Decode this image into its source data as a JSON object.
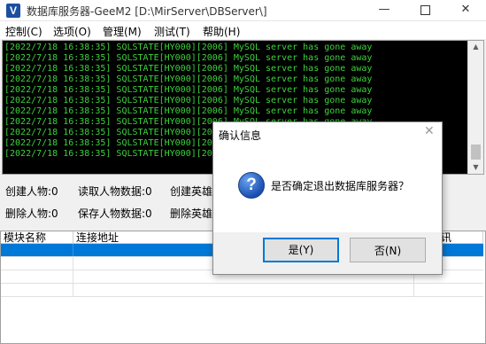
{
  "window": {
    "title": "数据库服务器-GeeM2  [D:\\MirServer\\DBServer\\]",
    "icon_letter": "V",
    "minimize": "—",
    "close": "✕"
  },
  "menu": [
    "控制(C)",
    "选项(O)",
    "管理(M)",
    "测试(T)",
    "帮助(H)"
  ],
  "log_lines": [
    "[2022/7/18 16:38:35] SQLSTATE[HY000][2006] MySQL server has gone away",
    "[2022/7/18 16:38:35] SQLSTATE[HY000][2006] MySQL server has gone away",
    "[2022/7/18 16:38:35] SQLSTATE[HY000][2006] MySQL server has gone away",
    "[2022/7/18 16:38:35] SQLSTATE[HY000][2006] MySQL server has gone away",
    "[2022/7/18 16:38:35] SQLSTATE[HY000][2006] MySQL server has gone away",
    "[2022/7/18 16:38:35] SQLSTATE[HY000][2006] MySQL server has gone away",
    "[2022/7/18 16:38:35] SQLSTATE[HY000][2006] MySQL server has gone away",
    "[2022/7/18 16:38:35] SQLSTATE[HY000][2006] MySQL server has gone away",
    "[2022/7/18 16:38:35] SQLSTATE[HY000][2006] MySQL server has gone away",
    "[2022/7/18 16:38:35] SQLSTATE[HY000][2006] MySQL server has gone away",
    "[2022/7/18 16:38:35] SQLSTATE[HY000][2006] MySQL server has gone away"
  ],
  "stats": {
    "create_char": "创建人物:0",
    "read_char": "读取人物数据:0",
    "create_hero": "创建英雄",
    "delete_char": "删除人物:0",
    "save_char": "保存人物数据:0",
    "delete_hero": "删除英雄"
  },
  "table": {
    "columns": [
      "模块名称",
      "连接地址",
      "讯"
    ]
  },
  "dialog": {
    "title": "确认信息",
    "close": "✕",
    "icon_glyph": "?",
    "message": "是否确定退出数据库服务器？",
    "yes": "是(Y)",
    "no": "否(N)"
  },
  "colors": {
    "log_text": "#3cd23c",
    "selection": "#0078d7"
  }
}
